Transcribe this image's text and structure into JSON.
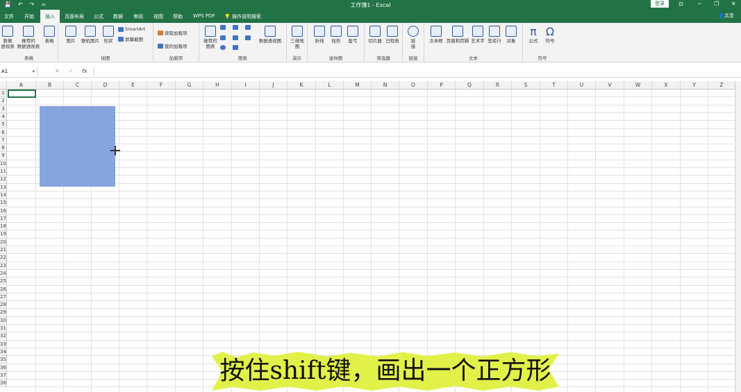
{
  "titlebar": {
    "title": "工作簿1 - Excel",
    "login": "登录",
    "minimize": "─",
    "restore": "❐",
    "close": "✕",
    "save_icon": "💾",
    "undo": "↶",
    "redo": "↷",
    "customize": "="
  },
  "menu": {
    "file": "文件",
    "home": "开始",
    "insert": "插入",
    "layout": "页面布局",
    "formula": "公式",
    "data": "数据",
    "review": "审阅",
    "view": "视图",
    "help": "帮助",
    "wps": "WPS PDF",
    "search": "操作说明搜索",
    "share": "共享"
  },
  "ribbon": {
    "tables": {
      "pivot": "数据\n透视表",
      "rec_pivot": "推荐的\n数据透视表",
      "table": "表格",
      "label": "表格"
    },
    "illus": {
      "picture": "图片",
      "online": "联机图片",
      "shapes": "形状",
      "smartart": "SmartArt",
      "screenshot": "屏幕截图",
      "label": "插图"
    },
    "addins": {
      "get": "获取加载项",
      "mine": "我的加载项",
      "label": "加载项"
    },
    "charts": {
      "recommended": "推荐的\n图表",
      "pivotchart": "数据透视图",
      "label": "图表"
    },
    "tours": {
      "map3d": "三维地\n图",
      "label": "演示"
    },
    "spark": {
      "line": "折线",
      "column": "柱形",
      "winloss": "盈亏",
      "label": "迷你图"
    },
    "filters": {
      "slicer": "切片器",
      "timeline": "日程表",
      "label": "筛选器"
    },
    "links": {
      "link": "链\n接",
      "label": "链接"
    },
    "text": {
      "textbox": "文本框",
      "header": "页眉和页脚",
      "wordart": "艺术字",
      "signature": "签名行",
      "object": "对象",
      "label": "文本"
    },
    "symbols": {
      "equation": "公式",
      "symbol": "符号",
      "label": "符号"
    }
  },
  "formula_bar": {
    "cell": "A1",
    "cancel": "✕",
    "enter": "✓",
    "fx": "fx",
    "value": ""
  },
  "columns": [
    "A",
    "B",
    "C",
    "D",
    "E",
    "F",
    "G",
    "H",
    "I",
    "J",
    "K",
    "L",
    "M",
    "N",
    "O",
    "P",
    "Q",
    "R",
    "S",
    "T",
    "U",
    "V",
    "W",
    "X",
    "Y",
    "Z"
  ],
  "rows": [
    "1",
    "2",
    "3",
    "4",
    "5",
    "6",
    "7",
    "8",
    "9",
    "10",
    "11",
    "12",
    "13",
    "14",
    "15",
    "16",
    "17",
    "18",
    "19",
    "20",
    "21",
    "22",
    "23",
    "24",
    "25",
    "26",
    "27",
    "28",
    "29",
    "30",
    "31",
    "32",
    "33",
    "34",
    "35",
    "36",
    "37",
    "38"
  ],
  "caption": "按住shift键，画出一个正方形"
}
